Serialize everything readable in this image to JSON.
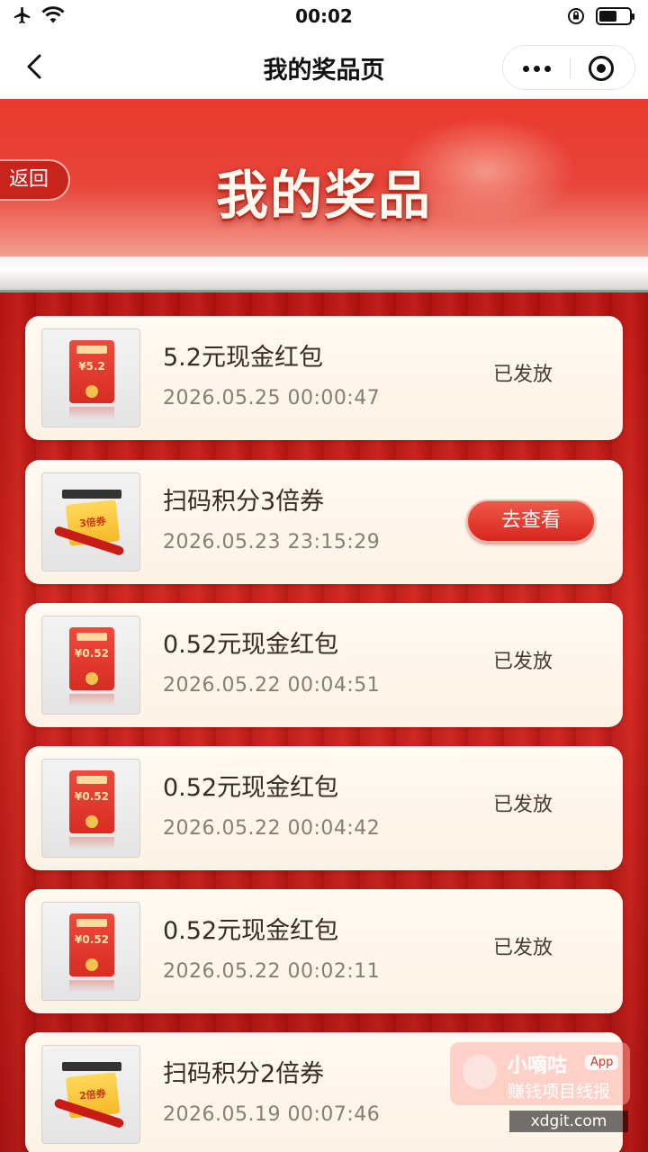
{
  "status_bar": {
    "time": "00:02",
    "battery_level": 0.6
  },
  "nav": {
    "title": "我的奖品页"
  },
  "banner": {
    "title": "我的奖品",
    "back_label": "返回"
  },
  "items": [
    {
      "title": "5.2元现金红包",
      "time": "2026.05.25 00:00:47",
      "status": "已发放",
      "thumb": "red-envelope",
      "amount": "¥5.2"
    },
    {
      "title": "扫码积分3倍券",
      "time": "2026.05.23 23:15:29",
      "action": "去查看",
      "thumb": "coupon",
      "coupon_text": "3倍券"
    },
    {
      "title": "0.52元现金红包",
      "time": "2026.05.22 00:04:51",
      "status": "已发放",
      "thumb": "red-envelope",
      "amount": "¥0.52"
    },
    {
      "title": "0.52元现金红包",
      "time": "2026.05.22 00:04:42",
      "status": "已发放",
      "thumb": "red-envelope",
      "amount": "¥0.52"
    },
    {
      "title": "0.52元现金红包",
      "time": "2026.05.22 00:02:11",
      "status": "已发放",
      "thumb": "red-envelope",
      "amount": "¥0.52"
    },
    {
      "title": "扫码积分2倍券",
      "time": "2026.05.19 00:07:46",
      "thumb": "coupon",
      "coupon_text": "2倍券"
    }
  ],
  "watermark": {
    "name": "小嘀咕",
    "tag": "App",
    "slogan": "赚钱项目线报",
    "url": "xdgit.com"
  }
}
